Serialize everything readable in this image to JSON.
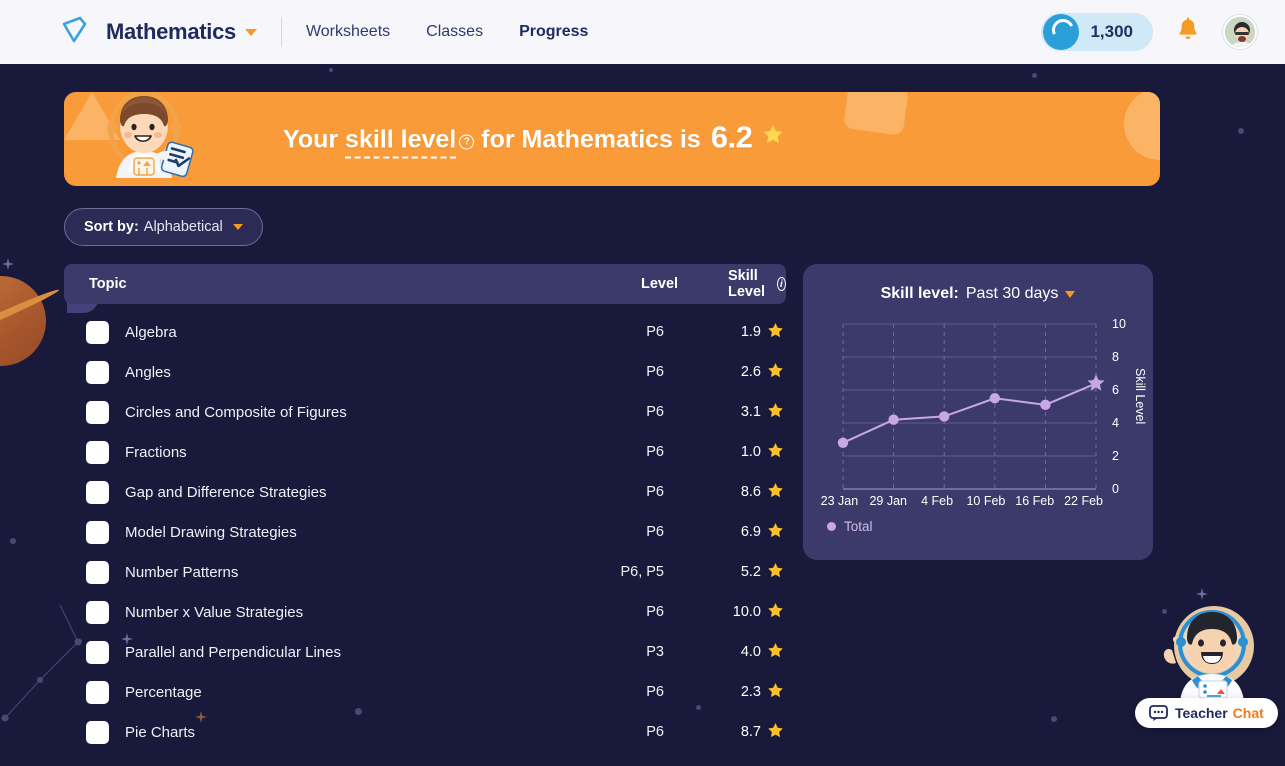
{
  "nav": {
    "logo_icon": "diamond-logo-icon",
    "brand": "Mathematics",
    "brand_caret_icon": "caret-down-icon",
    "links": [
      {
        "label": "Worksheets",
        "active": false
      },
      {
        "label": "Classes",
        "active": false
      },
      {
        "label": "Progress",
        "active": true
      }
    ],
    "coins": "1,300",
    "coin_icon": "coin-icon",
    "bell_icon": "bell-icon",
    "avatar_icon": "user-avatar"
  },
  "banner": {
    "prefix": "Your",
    "term": "skill level",
    "info_icon": "?",
    "middle": "for Mathematics is",
    "score": "6.2",
    "star_icon": "star-icon",
    "mascot_icon": "astronaut-mascot-icon",
    "bg_color": "#f99b38"
  },
  "sort": {
    "label": "Sort by:",
    "value": "Alphabetical",
    "caret_icon": "caret-down-icon"
  },
  "table": {
    "columns": [
      "Topic",
      "Level",
      "Skill Level"
    ],
    "skill_info_icon": "info-icon",
    "rows": [
      {
        "topic": "Algebra",
        "level": "P6",
        "skill": "1.9"
      },
      {
        "topic": "Angles",
        "level": "P6",
        "skill": "2.6"
      },
      {
        "topic": "Circles and Composite of Figures",
        "level": "P6",
        "skill": "3.1"
      },
      {
        "topic": "Fractions",
        "level": "P6",
        "skill": "1.0"
      },
      {
        "topic": "Gap and Difference Strategies",
        "level": "P6",
        "skill": "8.6"
      },
      {
        "topic": "Model Drawing Strategies",
        "level": "P6",
        "skill": "6.9"
      },
      {
        "topic": "Number Patterns",
        "level": "P6, P5",
        "skill": "5.2"
      },
      {
        "topic": "Number x Value Strategies",
        "level": "P6",
        "skill": "10.0"
      },
      {
        "topic": "Parallel and Perpendicular Lines",
        "level": "P3",
        "skill": "4.0"
      },
      {
        "topic": "Percentage",
        "level": "P6",
        "skill": "2.3"
      },
      {
        "topic": "Pie Charts",
        "level": "P6",
        "skill": "8.7"
      }
    ]
  },
  "chart_panel": {
    "title_label": "Skill level:",
    "range_value": "Past 30 days",
    "caret_icon": "caret-down-icon",
    "legend": "Total"
  },
  "chart_data": {
    "type": "line",
    "title": "Skill level: Past 30 days",
    "xlabel": "",
    "ylabel": "Skill Level",
    "x": [
      "23 Jan",
      "29 Jan",
      "4 Feb",
      "10 Feb",
      "16 Feb",
      "22 Feb"
    ],
    "series": [
      {
        "name": "Total",
        "values": [
          2.8,
          4.2,
          4.4,
          5.5,
          5.1,
          6.4
        ],
        "color": "#c9a6e8"
      }
    ],
    "ylim": [
      0,
      10
    ],
    "yticks": [
      0,
      2,
      4,
      6,
      8,
      10
    ],
    "grid": true,
    "legend_position": "bottom-left",
    "last_point_marker": "star"
  },
  "chat": {
    "title_part1": "Teacher",
    "title_part2": "Chat",
    "bubble_icon": "chat-bubble-icon",
    "avatar_icon": "astronaut-teacher-icon"
  }
}
